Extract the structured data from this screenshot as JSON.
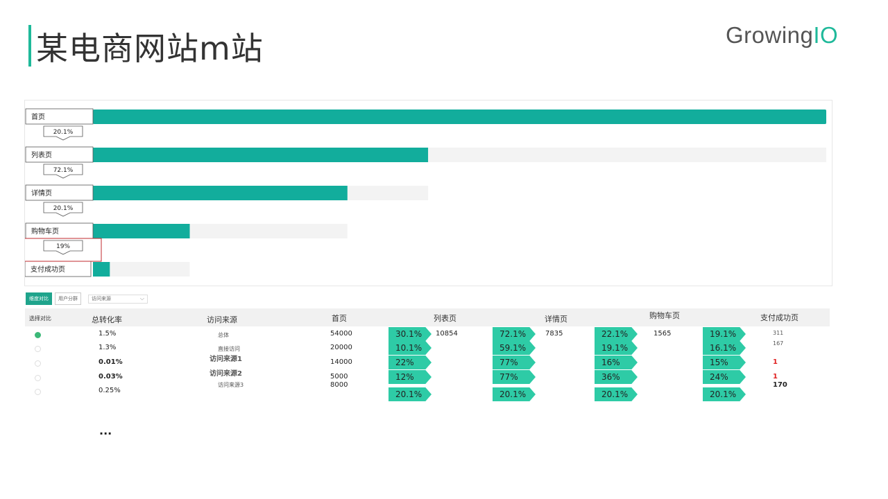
{
  "header": {
    "title": "某电商网站m站",
    "logo_main": "Growing",
    "logo_io": "IO"
  },
  "chart_data": {
    "type": "bar",
    "subtype": "funnel",
    "categories": [
      "首页",
      "列表页",
      "详情页",
      "购物车页",
      "支付成功页"
    ],
    "values": [
      100,
      45.7,
      34.7,
      13.2,
      2.3
    ],
    "conversion_labels": [
      "20.1%",
      "72.1%",
      "20.1%",
      "19%"
    ],
    "colors": {
      "bar": "#12ad9c",
      "track": "#f3f3f3"
    }
  },
  "tabs": {
    "active": "维度对比",
    "other": "用户分群",
    "select_value": "访问来源"
  },
  "table": {
    "headers": [
      "选择对比",
      "总转化率",
      "访问来源",
      "首页",
      "列表页",
      "详情页",
      "购物车页",
      "支付成功页"
    ],
    "rows": [
      {
        "rate": "1.5%",
        "source": "总体",
        "home": "54000",
        "a1": "30.1%",
        "list": "10854",
        "a2": "72.1%",
        "detail": "7835",
        "a3": "22.1%",
        "cart": "1565",
        "a4": "19.1%",
        "pay": "311"
      },
      {
        "rate": "1.3%",
        "source": "直接访问",
        "home": "20000",
        "a1": "10.1%",
        "list": "",
        "a2": "59.1%",
        "detail": "",
        "a3": "19.1%",
        "cart": "",
        "a4": "16.1%",
        "pay": "167"
      },
      {
        "rate": "0.01%",
        "source": "访问来源1",
        "home": "14000",
        "a1": "22%",
        "list": "",
        "a2": "77%",
        "detail": "",
        "a3": "16%",
        "cart": "",
        "a4": "15%",
        "pay": "1"
      },
      {
        "rate": "0.03%",
        "source": "访问来源2",
        "home": "5000",
        "a1": "12%",
        "list": "",
        "a2": "77%",
        "detail": "",
        "a3": "36%",
        "cart": "",
        "a4": "24%",
        "pay": "1"
      },
      {
        "rate": "0.25%",
        "source": "访问来源3",
        "home": "8000",
        "a1": "20.1%",
        "list": "",
        "a2": "20.1%",
        "detail": "",
        "a3": "20.1%",
        "cart": "",
        "a4": "20.1%",
        "pay": "170"
      }
    ]
  },
  "ellipsis": "..."
}
